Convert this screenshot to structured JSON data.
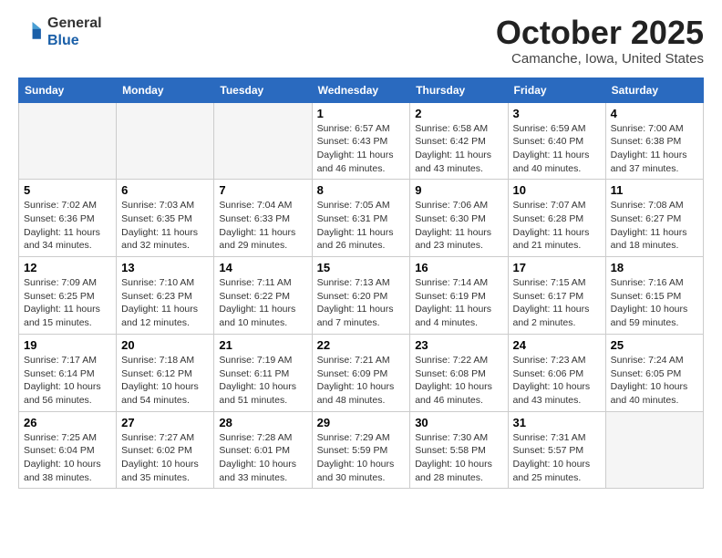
{
  "header": {
    "logo_general": "General",
    "logo_blue": "Blue",
    "month_title": "October 2025",
    "location": "Camanche, Iowa, United States"
  },
  "days_of_week": [
    "Sunday",
    "Monday",
    "Tuesday",
    "Wednesday",
    "Thursday",
    "Friday",
    "Saturday"
  ],
  "weeks": [
    [
      {
        "day": "",
        "empty": true
      },
      {
        "day": "",
        "empty": true
      },
      {
        "day": "",
        "empty": true
      },
      {
        "day": "1",
        "sunrise": "6:57 AM",
        "sunset": "6:43 PM",
        "daylight": "11 hours and 46 minutes."
      },
      {
        "day": "2",
        "sunrise": "6:58 AM",
        "sunset": "6:42 PM",
        "daylight": "11 hours and 43 minutes."
      },
      {
        "day": "3",
        "sunrise": "6:59 AM",
        "sunset": "6:40 PM",
        "daylight": "11 hours and 40 minutes."
      },
      {
        "day": "4",
        "sunrise": "7:00 AM",
        "sunset": "6:38 PM",
        "daylight": "11 hours and 37 minutes."
      }
    ],
    [
      {
        "day": "5",
        "sunrise": "7:02 AM",
        "sunset": "6:36 PM",
        "daylight": "11 hours and 34 minutes."
      },
      {
        "day": "6",
        "sunrise": "7:03 AM",
        "sunset": "6:35 PM",
        "daylight": "11 hours and 32 minutes."
      },
      {
        "day": "7",
        "sunrise": "7:04 AM",
        "sunset": "6:33 PM",
        "daylight": "11 hours and 29 minutes."
      },
      {
        "day": "8",
        "sunrise": "7:05 AM",
        "sunset": "6:31 PM",
        "daylight": "11 hours and 26 minutes."
      },
      {
        "day": "9",
        "sunrise": "7:06 AM",
        "sunset": "6:30 PM",
        "daylight": "11 hours and 23 minutes."
      },
      {
        "day": "10",
        "sunrise": "7:07 AM",
        "sunset": "6:28 PM",
        "daylight": "11 hours and 21 minutes."
      },
      {
        "day": "11",
        "sunrise": "7:08 AM",
        "sunset": "6:27 PM",
        "daylight": "11 hours and 18 minutes."
      }
    ],
    [
      {
        "day": "12",
        "sunrise": "7:09 AM",
        "sunset": "6:25 PM",
        "daylight": "11 hours and 15 minutes."
      },
      {
        "day": "13",
        "sunrise": "7:10 AM",
        "sunset": "6:23 PM",
        "daylight": "11 hours and 12 minutes."
      },
      {
        "day": "14",
        "sunrise": "7:11 AM",
        "sunset": "6:22 PM",
        "daylight": "11 hours and 10 minutes."
      },
      {
        "day": "15",
        "sunrise": "7:13 AM",
        "sunset": "6:20 PM",
        "daylight": "11 hours and 7 minutes."
      },
      {
        "day": "16",
        "sunrise": "7:14 AM",
        "sunset": "6:19 PM",
        "daylight": "11 hours and 4 minutes."
      },
      {
        "day": "17",
        "sunrise": "7:15 AM",
        "sunset": "6:17 PM",
        "daylight": "11 hours and 2 minutes."
      },
      {
        "day": "18",
        "sunrise": "7:16 AM",
        "sunset": "6:15 PM",
        "daylight": "10 hours and 59 minutes."
      }
    ],
    [
      {
        "day": "19",
        "sunrise": "7:17 AM",
        "sunset": "6:14 PM",
        "daylight": "10 hours and 56 minutes."
      },
      {
        "day": "20",
        "sunrise": "7:18 AM",
        "sunset": "6:12 PM",
        "daylight": "10 hours and 54 minutes."
      },
      {
        "day": "21",
        "sunrise": "7:19 AM",
        "sunset": "6:11 PM",
        "daylight": "10 hours and 51 minutes."
      },
      {
        "day": "22",
        "sunrise": "7:21 AM",
        "sunset": "6:09 PM",
        "daylight": "10 hours and 48 minutes."
      },
      {
        "day": "23",
        "sunrise": "7:22 AM",
        "sunset": "6:08 PM",
        "daylight": "10 hours and 46 minutes."
      },
      {
        "day": "24",
        "sunrise": "7:23 AM",
        "sunset": "6:06 PM",
        "daylight": "10 hours and 43 minutes."
      },
      {
        "day": "25",
        "sunrise": "7:24 AM",
        "sunset": "6:05 PM",
        "daylight": "10 hours and 40 minutes."
      }
    ],
    [
      {
        "day": "26",
        "sunrise": "7:25 AM",
        "sunset": "6:04 PM",
        "daylight": "10 hours and 38 minutes."
      },
      {
        "day": "27",
        "sunrise": "7:27 AM",
        "sunset": "6:02 PM",
        "daylight": "10 hours and 35 minutes."
      },
      {
        "day": "28",
        "sunrise": "7:28 AM",
        "sunset": "6:01 PM",
        "daylight": "10 hours and 33 minutes."
      },
      {
        "day": "29",
        "sunrise": "7:29 AM",
        "sunset": "5:59 PM",
        "daylight": "10 hours and 30 minutes."
      },
      {
        "day": "30",
        "sunrise": "7:30 AM",
        "sunset": "5:58 PM",
        "daylight": "10 hours and 28 minutes."
      },
      {
        "day": "31",
        "sunrise": "7:31 AM",
        "sunset": "5:57 PM",
        "daylight": "10 hours and 25 minutes."
      },
      {
        "day": "",
        "empty": true
      }
    ]
  ],
  "labels": {
    "sunrise_prefix": "Sunrise: ",
    "sunset_prefix": "Sunset: ",
    "daylight_prefix": "Daylight: "
  }
}
